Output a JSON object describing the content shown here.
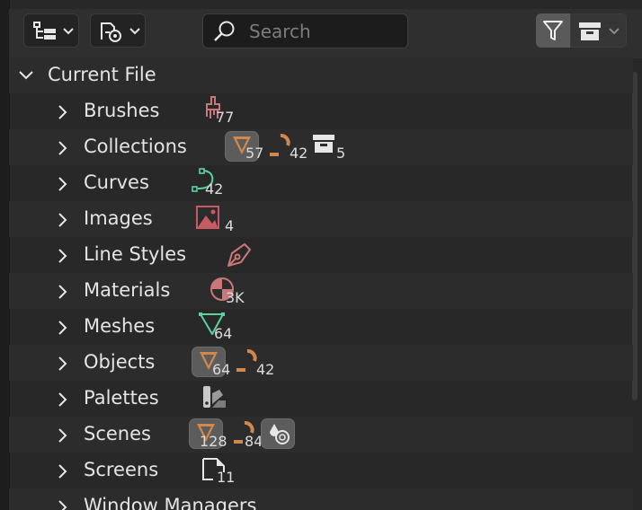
{
  "search": {
    "placeholder": "Search"
  },
  "tree": {
    "root_label": "Current File",
    "items": [
      {
        "label": "Brushes",
        "counts": [
          "77"
        ]
      },
      {
        "label": "Collections",
        "counts": [
          "57",
          "42",
          "5"
        ]
      },
      {
        "label": "Curves",
        "counts": [
          "42"
        ]
      },
      {
        "label": "Images",
        "counts": [
          "4"
        ]
      },
      {
        "label": "Line Styles",
        "counts": []
      },
      {
        "label": "Materials",
        "counts": [
          "3K"
        ]
      },
      {
        "label": "Meshes",
        "counts": [
          "64"
        ]
      },
      {
        "label": "Objects",
        "counts": [
          "64",
          "42"
        ]
      },
      {
        "label": "Palettes",
        "counts": []
      },
      {
        "label": "Scenes",
        "counts": [
          "128",
          "84"
        ]
      },
      {
        "label": "Screens",
        "counts": [
          "11"
        ]
      },
      {
        "label": "Window Managers",
        "counts": []
      }
    ]
  },
  "colors": {
    "brush": "#c87878",
    "curve": "#5ad2a0",
    "image": "#c85a64",
    "orange": "#d2874b",
    "archive": "#e6e6e6"
  }
}
